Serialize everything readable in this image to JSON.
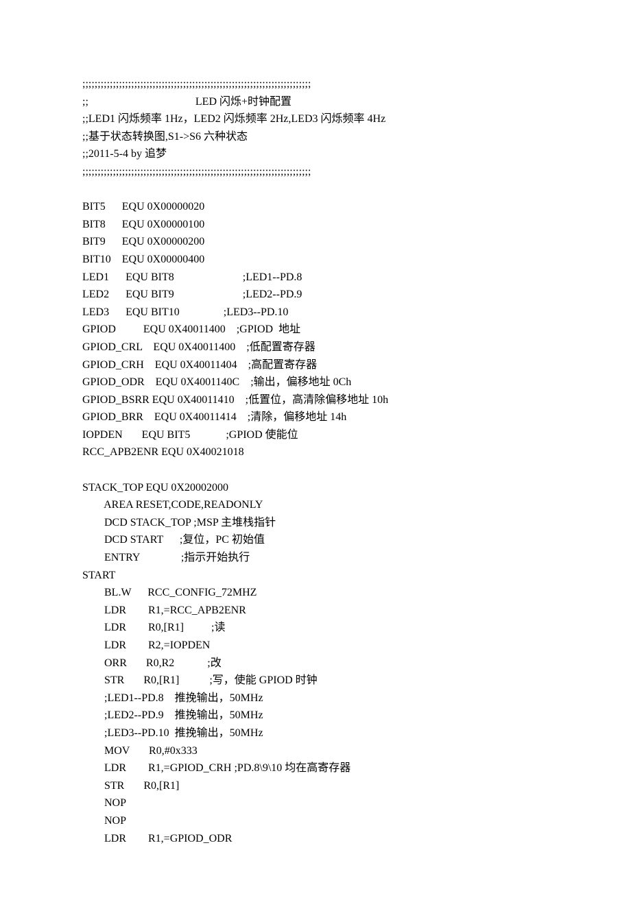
{
  "lines": [
    ";;;;;;;;;;;;;;;;;;;;;;;;;;;;;;;;;;;;;;;;;;;;;;;;;;;;;;;;;;;;;;;;;;;;;;;;;;;",
    ";;                                       LED 闪烁+时钟配置",
    ";;LED1 闪烁频率 1Hz，LED2 闪烁频率 2Hz,LED3 闪烁频率 4Hz",
    ";;基于状态转换图,S1->S6 六种状态",
    ";;2011-5-4 by 追梦",
    ";;;;;;;;;;;;;;;;;;;;;;;;;;;;;;;;;;;;;;;;;;;;;;;;;;;;;;;;;;;;;;;;;;;;;;;;;;;",
    "",
    "BIT5      EQU 0X00000020",
    "BIT8      EQU 0X00000100",
    "BIT9      EQU 0X00000200",
    "BIT10    EQU 0X00000400",
    "LED1      EQU BIT8                         ;LED1--PD.8",
    "LED2      EQU BIT9                         ;LED2--PD.9",
    "LED3      EQU BIT10                ;LED3--PD.10",
    "GPIOD          EQU 0X40011400    ;GPIOD  地址",
    "GPIOD_CRL    EQU 0X40011400    ;低配置寄存器",
    "GPIOD_CRH    EQU 0X40011404    ;高配置寄存器",
    "GPIOD_ODR    EQU 0X4001140C    ;输出，偏移地址 0Ch",
    "GPIOD_BSRR EQU 0X40011410    ;低置位，高清除偏移地址 10h",
    "GPIOD_BRR    EQU 0X40011414    ;清除，偏移地址 14h",
    "IOPDEN       EQU BIT5             ;GPIOD 使能位",
    "RCC_APB2ENR EQU 0X40021018",
    "",
    "STACK_TOP EQU 0X20002000",
    "        AREA RESET,CODE,READONLY",
    "        DCD STACK_TOP ;MSP 主堆栈指针",
    "        DCD START      ;复位，PC 初始值",
    "        ENTRY               ;指示开始执行",
    "START",
    "        BL.W      RCC_CONFIG_72MHZ",
    "        LDR        R1,=RCC_APB2ENR",
    "        LDR        R0,[R1]          ;读",
    "        LDR        R2,=IOPDEN",
    "        ORR       R0,R2            ;改",
    "        STR       R0,[R1]           ;写，使能 GPIOD 时钟",
    "        ;LED1--PD.8    推挽输出，50MHz",
    "        ;LED2--PD.9    推挽输出，50MHz",
    "        ;LED3--PD.10  推挽输出，50MHz",
    "        MOV       R0,#0x333",
    "        LDR        R1,=GPIOD_CRH ;PD.8\\9\\10 均在高寄存器",
    "        STR       R0,[R1]",
    "        NOP",
    "        NOP",
    "        LDR        R1,=GPIOD_ODR"
  ]
}
